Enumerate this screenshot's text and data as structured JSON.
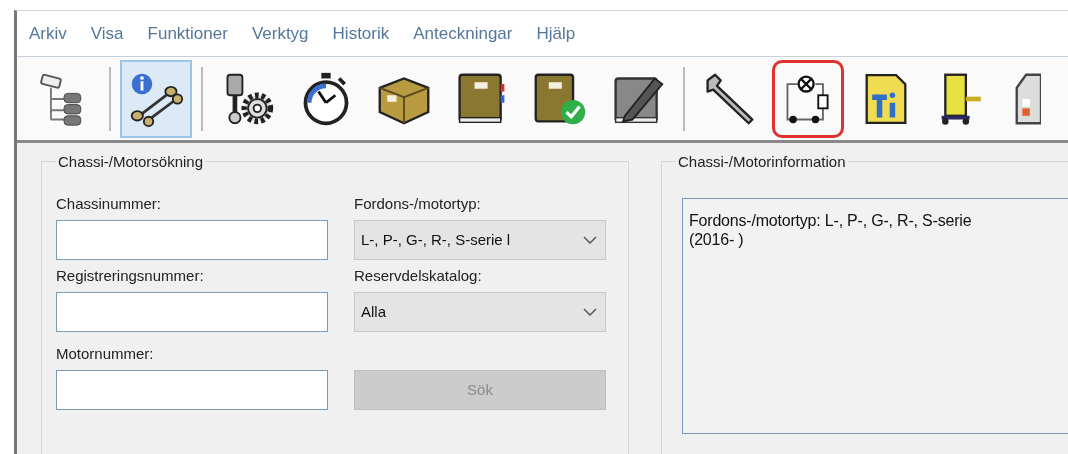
{
  "menu": [
    "Arkiv",
    "Visa",
    "Funktioner",
    "Verktyg",
    "Historik",
    "Anteckningar",
    "Hjälp"
  ],
  "toolbar": [
    {
      "selected": false,
      "highlighted": false
    },
    {
      "selected": true,
      "highlighted": false
    },
    {
      "selected": false,
      "highlighted": false
    },
    {
      "selected": false,
      "highlighted": false
    },
    {
      "selected": false,
      "highlighted": false
    },
    {
      "selected": false,
      "highlighted": false
    },
    {
      "selected": false,
      "highlighted": false
    },
    {
      "selected": false,
      "highlighted": false
    },
    {
      "selected": false,
      "highlighted": false
    },
    {
      "selected": false,
      "highlighted": true
    },
    {
      "selected": false,
      "highlighted": false
    },
    {
      "selected": false,
      "highlighted": false
    },
    {
      "selected": false,
      "highlighted": false
    }
  ],
  "search_group": {
    "title": "Chassi-/Motorsökning",
    "fields": [
      {
        "label": "Chassinummer:"
      },
      {
        "label": "Registreringsnummer:"
      },
      {
        "label": "Motornummer:"
      }
    ],
    "dropdowns": [
      {
        "label": "Fordons-/motortyp:",
        "value": "L-, P-, G-, R-, S-serie l"
      },
      {
        "label": "Reservdelskatalog:",
        "value": "Alla"
      }
    ],
    "search_button": {
      "label": "Sök",
      "disabled": true
    }
  },
  "info_group": {
    "title": "Chassi-/Motorinformation",
    "lines": [
      "Fordons-/motortyp: L-, P-, G-, R-, S-serie",
      "(2016- )"
    ]
  }
}
